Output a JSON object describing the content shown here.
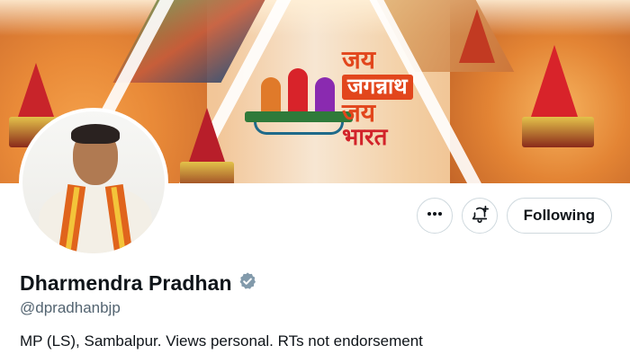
{
  "banner": {
    "slogan_line1": "जय",
    "slogan_line2": "जगन्नाथ",
    "slogan_line3": "जय",
    "slogan_line4": "भारत"
  },
  "profile": {
    "display_name": "Dharmendra Pradhan",
    "handle": "@dpradhanbjp",
    "bio": "MP (LS), Sambalpur. Views personal. RTs not endorsement",
    "verified_badge": "verified-badge-icon",
    "badge_color": "#829aab"
  },
  "actions": {
    "more_icon": "more-horizontal-icon",
    "notify_icon": "bell-plus-icon",
    "follow_label": "Following"
  }
}
